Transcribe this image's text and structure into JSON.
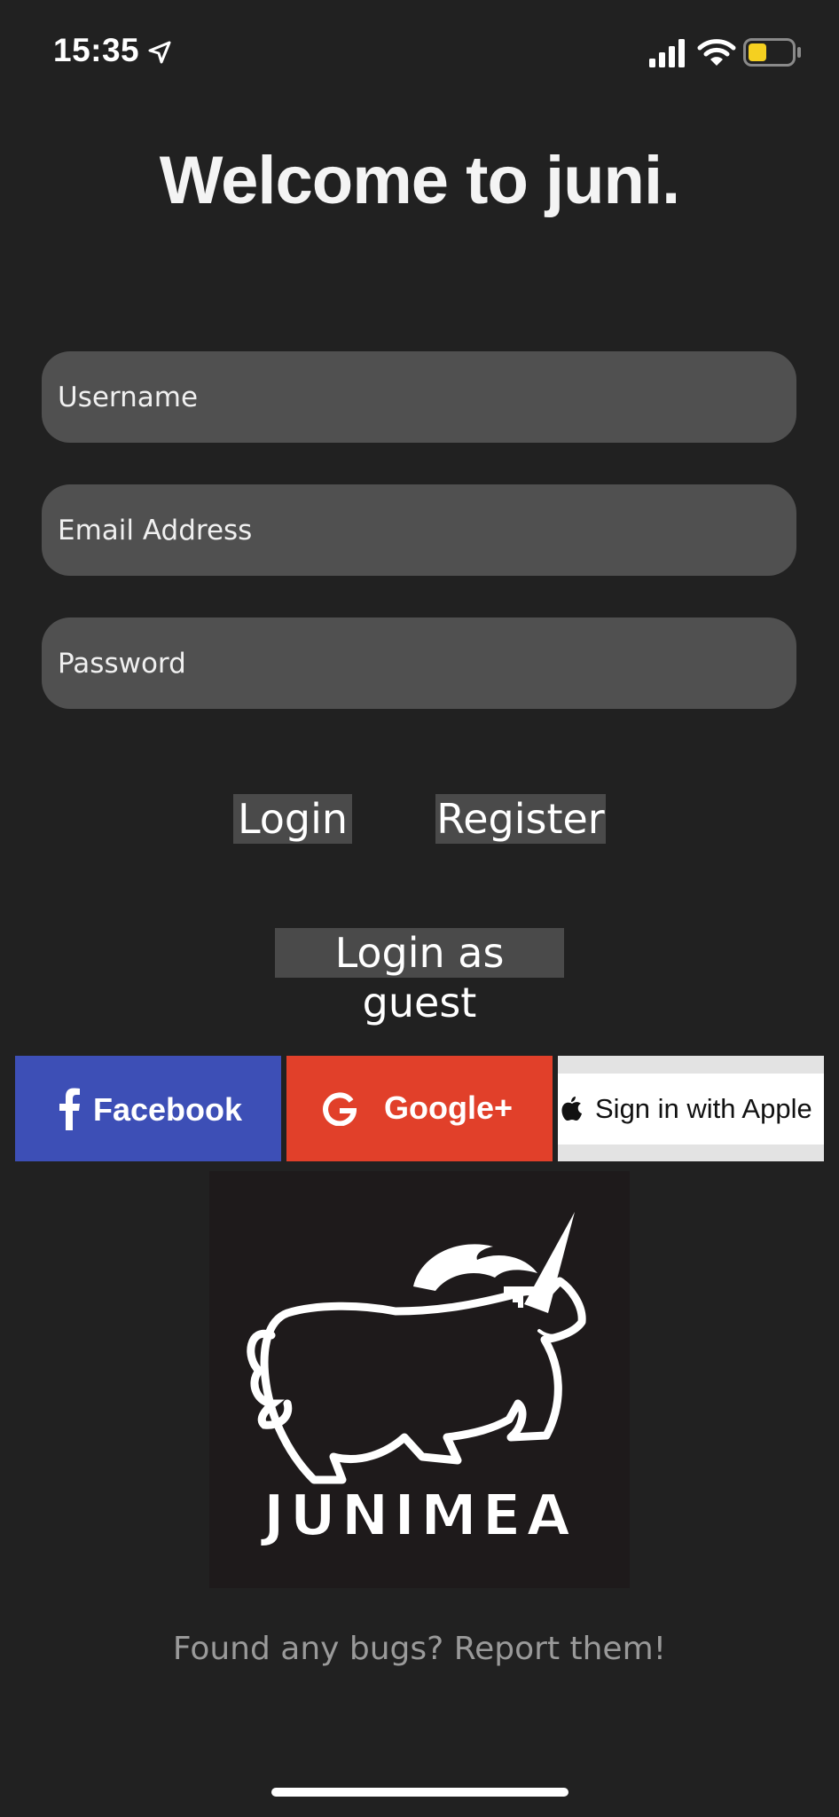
{
  "status_bar": {
    "time": "15:35",
    "battery_color": "#f5d020"
  },
  "welcome": {
    "title": "Welcome to juni."
  },
  "form": {
    "username_placeholder": "Username",
    "email_placeholder": "Email Address",
    "password_placeholder": "Password"
  },
  "actions": {
    "login_label": "Login",
    "register_label": "Register",
    "guest_label": "Login as guest"
  },
  "social": {
    "facebook_label": "Facebook",
    "facebook_color": "#3d4fb6",
    "google_label": "Google+",
    "google_color": "#e1402a",
    "apple_label": "Sign in with Apple"
  },
  "logo": {
    "text": "JUNIMEA"
  },
  "footer": {
    "report_label": "Found any bugs? Report them!"
  }
}
